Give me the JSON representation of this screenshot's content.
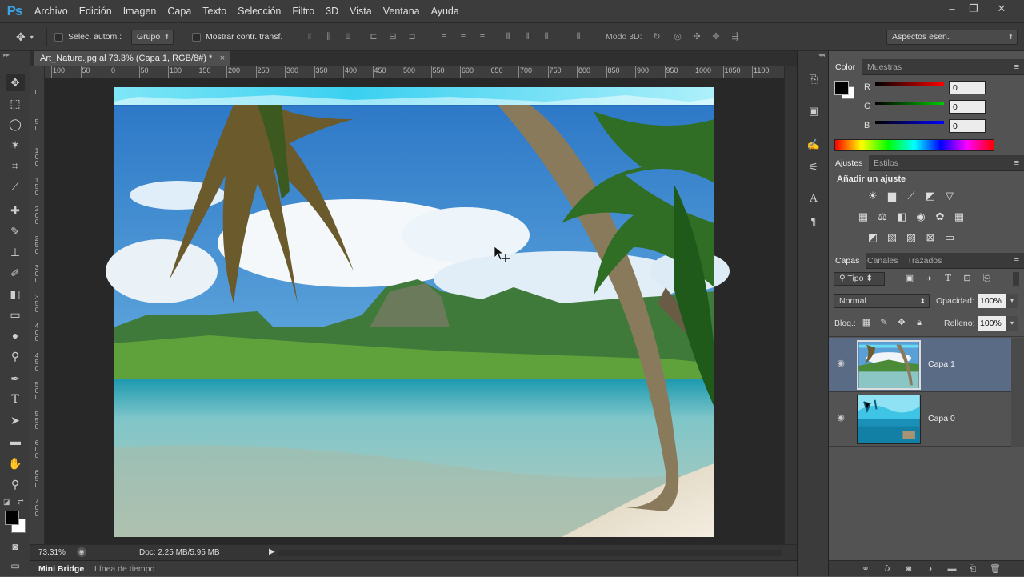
{
  "app": {
    "logo": "Ps"
  },
  "menu": [
    "Archivo",
    "Edición",
    "Imagen",
    "Capa",
    "Texto",
    "Selección",
    "Filtro",
    "3D",
    "Vista",
    "Ventana",
    "Ayuda"
  ],
  "window_controls": {
    "minimize": "–",
    "restore": "❐",
    "close": "✕"
  },
  "options": {
    "auto_select_label": "Selec. autom.:",
    "auto_select_value": "Grupo",
    "show_transform_label": "Mostrar contr. transf.",
    "mode3d_label": "Modo 3D:",
    "workspace": "Aspectos esen."
  },
  "document": {
    "tab_title": "Art_Nature.jpg al 73.3% (Capa 1, RGB/8#) *",
    "close": "×",
    "zoom": "73.31%",
    "doc_info": "Doc: 2.25 MB/5.95 MB"
  },
  "ruler_h": [
    "100",
    "50",
    "0",
    "50",
    "100",
    "150",
    "200",
    "250",
    "300",
    "350",
    "400",
    "450",
    "500",
    "550",
    "600",
    "650",
    "700",
    "750",
    "800",
    "850",
    "900",
    "950",
    "1000",
    "1050",
    "1100"
  ],
  "ruler_v": [
    "0",
    "5 0",
    "1 0 0",
    "1 5 0",
    "2 0 0",
    "2 5 0",
    "3 0 0",
    "3 5 0",
    "4 0 0",
    "4 5 0",
    "5 0 0",
    "5 5 0",
    "6 0 0",
    "6 5 0",
    "7 0 0"
  ],
  "bottom_tabs": [
    "Mini Bridge",
    "Línea de tiempo"
  ],
  "color_panel": {
    "tabs": [
      "Color",
      "Muestras"
    ],
    "r_label": "R",
    "g_label": "G",
    "b_label": "B",
    "r": "0",
    "g": "0",
    "b": "0",
    "menu": "≡"
  },
  "adjust_panel": {
    "tabs": [
      "Ajustes",
      "Estilos"
    ],
    "title": "Añadir un ajuste"
  },
  "layers_panel": {
    "tabs": [
      "Capas",
      "Canales",
      "Trazados"
    ],
    "filter": "Tipo",
    "blend_mode": "Normal",
    "opacity_label": "Opacidad:",
    "opacity": "100%",
    "lock_label": "Bloq.:",
    "fill_label": "Relleno:",
    "fill": "100%",
    "layers": [
      {
        "name": "Capa 1",
        "selected": true
      },
      {
        "name": "Capa 0",
        "selected": false
      }
    ],
    "footer_icons": [
      "link-icon",
      "fx-icon",
      "mask-icon",
      "adjustment-icon",
      "folder-icon",
      "new-layer-icon",
      "trash-icon"
    ],
    "fx": "fx"
  },
  "colors": {
    "accent": "#3aa4e8",
    "selected_layer": "#5a6b86",
    "panel_bg": "#535353"
  }
}
